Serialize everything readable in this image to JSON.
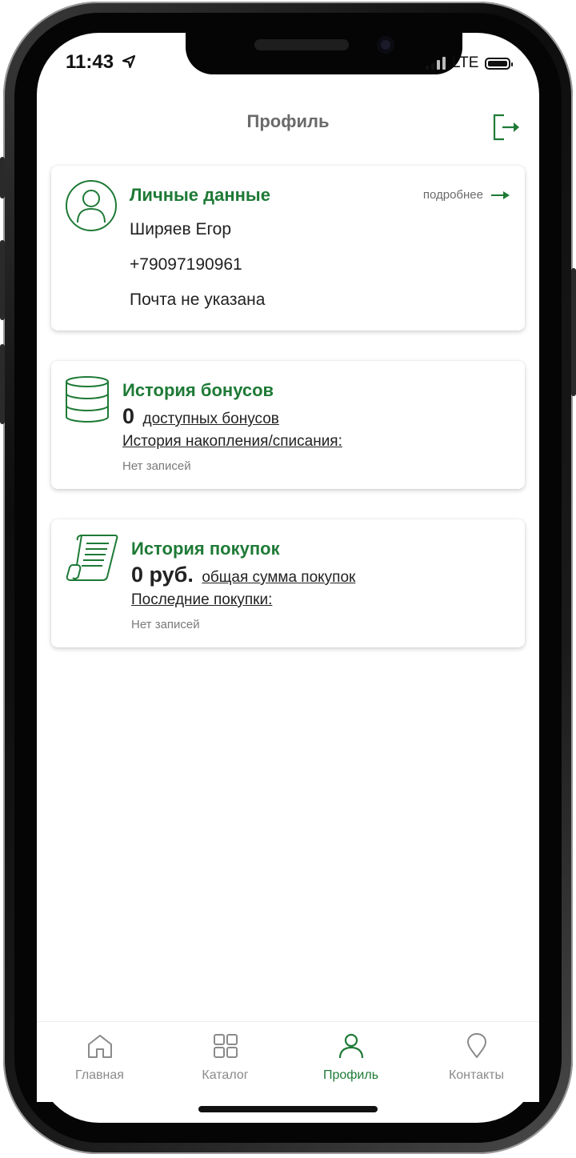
{
  "status": {
    "time": "11:43",
    "network": "LTE"
  },
  "header": {
    "title": "Профиль"
  },
  "personal": {
    "title": "Личные данные",
    "more_label": "подробнее",
    "name": "Ширяев Егор",
    "phone": "+79097190961",
    "email": "Почта не указана"
  },
  "bonus": {
    "title": "История бонусов",
    "amount": "0",
    "amount_label": "доступных бонусов",
    "history_link": "История накопления/списания:",
    "empty": "Нет записей"
  },
  "purchases": {
    "title": "История покупок",
    "amount": "0 руб.",
    "amount_label": "общая сумма покупок",
    "history_link": "Последние покупки:",
    "empty": "Нет записей"
  },
  "tabs": [
    {
      "label": "Главная",
      "icon": "home-icon"
    },
    {
      "label": "Каталог",
      "icon": "grid-icon"
    },
    {
      "label": "Профиль",
      "icon": "user-icon",
      "active": true
    },
    {
      "label": "Контакты",
      "icon": "map-pin-icon"
    }
  ],
  "colors": {
    "accent": "#1e7a36",
    "muted": "#8a8a8a"
  }
}
